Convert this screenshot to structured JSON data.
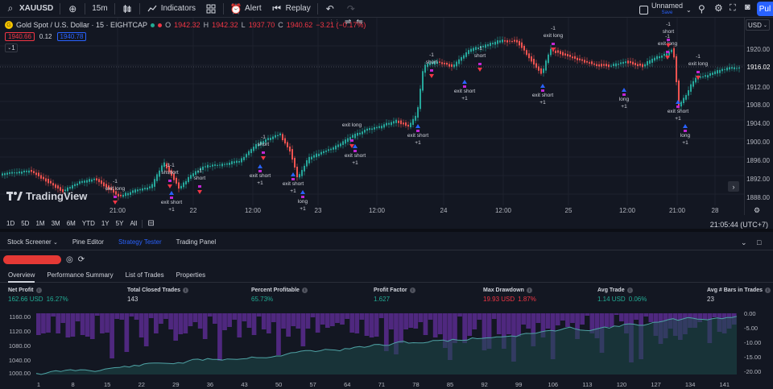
{
  "toolbar": {
    "symbol": "XAUUSD",
    "interval": "15m",
    "indicators": "Indicators",
    "alert": "Alert",
    "replay": "Replay",
    "layout_name": "Unnamed",
    "layout_status": "Save",
    "publish": "Pul"
  },
  "symbol_info": {
    "title": "Gold Spot / U.S. Dollar · 15 · EIGHTCAP",
    "gold_glyph": "G",
    "open_label": "O",
    "open": "1942.32",
    "high_label": "H",
    "high": "1942.32",
    "low_label": "L",
    "low": "1937.70",
    "close_label": "C",
    "close": "1940.62",
    "change": "−3.21 (−0.17%)",
    "bid": "1940.66",
    "spread": "0.12",
    "ask": "1940.78",
    "legend_count": "1"
  },
  "price_axis": {
    "currency": "USD",
    "labels": [
      "1920.00",
      "1912.00",
      "1908.00",
      "1904.00",
      "1900.00",
      "1896.00",
      "1892.00",
      "1888.00"
    ],
    "current_price": "1916.02",
    "price_tag_color": "#434651",
    "top_tag_color": "#434651"
  },
  "time_axis": {
    "labels": [
      "21:00",
      "22",
      "12:00",
      "23",
      "12:00",
      "24",
      "12:00",
      "25",
      "12:00",
      "21:00",
      "28"
    ]
  },
  "watermark": "TradingView",
  "range_bar": {
    "ranges": [
      "1D",
      "5D",
      "1M",
      "3M",
      "6M",
      "YTD",
      "1Y",
      "5Y",
      "All"
    ],
    "clock": "21:05:44 (UTC+7)"
  },
  "panel": {
    "tabs": [
      "Stock Screener",
      "Pine Editor",
      "Strategy Tester",
      "Trading Panel"
    ],
    "sub_tabs": [
      "Overview",
      "Performance Summary",
      "List of Trades",
      "Properties"
    ]
  },
  "metrics": [
    {
      "title": "Net Profit",
      "value": "162.66 USD",
      "pct": "16.27%",
      "tone": "pos"
    },
    {
      "title": "Total Closed Trades",
      "value": "143",
      "pct": "",
      "tone": "plain"
    },
    {
      "title": "Percent Profitable",
      "value": "65.73%",
      "pct": "",
      "tone": "pos"
    },
    {
      "title": "Profit Factor",
      "value": "1.627",
      "pct": "",
      "tone": "pos"
    },
    {
      "title": "Max Drawdown",
      "value": "19.93 USD",
      "pct": "1.87%",
      "tone": "neg"
    },
    {
      "title": "Avg Trade",
      "value": "1.14 USD",
      "pct": "0.06%",
      "tone": "pos"
    },
    {
      "title": "Avg # Bars in Trades",
      "value": "23",
      "pct": "",
      "tone": "plain"
    }
  ],
  "equity_axis": {
    "left": [
      "1160.00",
      "1120.00",
      "1080.00",
      "1040.00",
      "1000.00"
    ],
    "right": [
      "0.00",
      "-5.00",
      "-10.00",
      "-15.00",
      "-20.00"
    ],
    "x": [
      "1",
      "8",
      "15",
      "22",
      "29",
      "36",
      "43",
      "50",
      "57",
      "64",
      "71",
      "78",
      "85",
      "92",
      "99",
      "106",
      "113",
      "120",
      "127",
      "134",
      "141"
    ]
  },
  "trade_labels": [
    {
      "text": "-1",
      "text2": "exit long",
      "kind": "sell"
    },
    {
      "text": "-1-1",
      "text2": "shshort",
      "kind": "sell"
    },
    {
      "text": "-1",
      "text2": "short",
      "kind": "sell"
    },
    {
      "text": "exit short",
      "text2": "+1",
      "kind": "buy"
    },
    {
      "text": "exit short",
      "text2": "+1",
      "kind": "buy"
    },
    {
      "text": "-1",
      "text2": "short",
      "kind": "sell"
    },
    {
      "text": "exit short",
      "text2": "+1",
      "kind": "buy"
    },
    {
      "text": "exit short",
      "text2": "+1",
      "kind": "buy"
    },
    {
      "text": "long",
      "text2": "+1",
      "kind": "buy"
    },
    {
      "text": "exit long",
      "text2": "",
      "kind": "sell"
    },
    {
      "text": "exit short",
      "text2": "+1",
      "kind": "buy"
    },
    {
      "text": "-1",
      "text2": "short",
      "kind": "sell"
    },
    {
      "text": "-1",
      "text2": "short",
      "kind": "sell"
    },
    {
      "text": "exit short",
      "text2": "+1",
      "kind": "buy"
    },
    {
      "text": "-1",
      "text2": "exit long",
      "kind": "sell"
    },
    {
      "text": "exit short",
      "text2": "+1",
      "kind": "buy"
    },
    {
      "text": "long",
      "text2": "+1",
      "kind": "buy"
    },
    {
      "text": "-1",
      "text2": "exit long",
      "kind": "sell"
    },
    {
      "text": "-1",
      "text2": "short",
      "kind": "sell"
    },
    {
      "text": "-1",
      "text2": "exit long",
      "kind": "sell"
    },
    {
      "text": "exit short",
      "text2": "+1",
      "kind": "buy"
    },
    {
      "text": "long",
      "text2": "+1",
      "kind": "buy"
    }
  ]
}
